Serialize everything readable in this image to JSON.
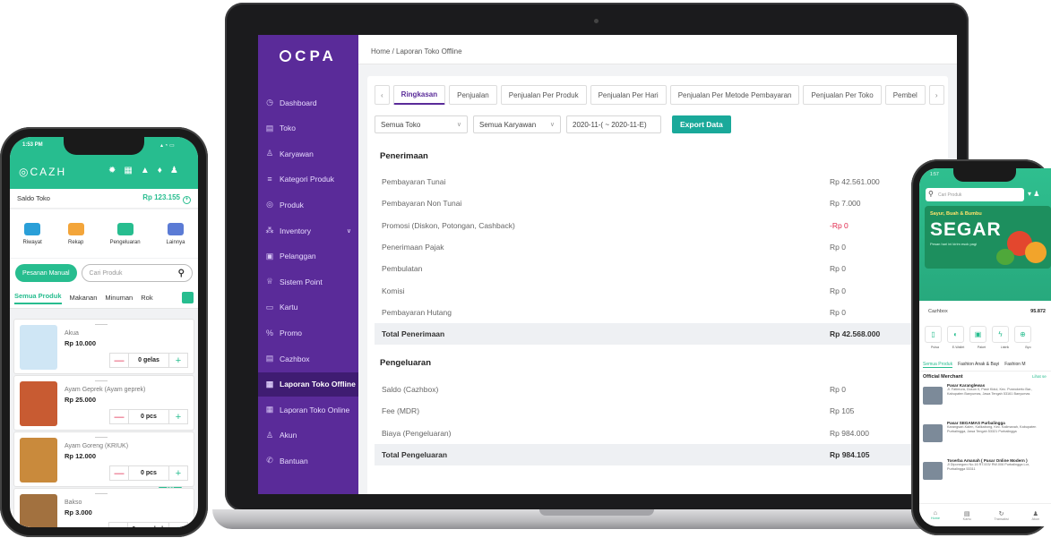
{
  "laptop": {
    "logo": "CPA",
    "sidebar": [
      {
        "label": "Dashboard",
        "icon": "dashboard-icon",
        "glyph": "◷"
      },
      {
        "label": "Toko",
        "icon": "store-icon",
        "glyph": "▤"
      },
      {
        "label": "Karyawan",
        "icon": "users-icon",
        "glyph": "♙"
      },
      {
        "label": "Kategori Produk",
        "icon": "list-icon",
        "glyph": "≡"
      },
      {
        "label": "Produk",
        "icon": "product-icon",
        "glyph": "◎"
      },
      {
        "label": "Inventory",
        "icon": "inventory-icon",
        "glyph": "⁂"
      },
      {
        "label": "Pelanggan",
        "icon": "customer-icon",
        "glyph": "▣"
      },
      {
        "label": "Sistem Point",
        "icon": "trophy-icon",
        "glyph": "♕"
      },
      {
        "label": "Kartu",
        "icon": "card-icon",
        "glyph": "▭"
      },
      {
        "label": "Promo",
        "icon": "percent-icon",
        "glyph": "%"
      },
      {
        "label": "Cazhbox",
        "icon": "box-icon",
        "glyph": "▤"
      },
      {
        "label": "Laporan Toko Offline",
        "icon": "report-icon",
        "glyph": "▦"
      },
      {
        "label": "Laporan Toko Online",
        "icon": "report-online-icon",
        "glyph": "▦"
      },
      {
        "label": "Akun",
        "icon": "account-icon",
        "glyph": "♙"
      },
      {
        "label": "Bantuan",
        "icon": "help-icon",
        "glyph": "✆"
      }
    ],
    "breadcrumb": "Home / Laporan Toko Offline",
    "tabs": [
      "Ringkasan",
      "Penjualan",
      "Penjualan Per Produk",
      "Penjualan Per Hari",
      "Penjualan Per Metode Pembayaran",
      "Penjualan Per Toko",
      "Pembel"
    ],
    "filters": {
      "store": "Semua Toko",
      "employee": "Semua Karyawan",
      "date": "2020-11-( ~ 2020-11-E)",
      "export": "Export Data"
    },
    "penerimaan": {
      "title": "Penerimaan",
      "rows": [
        {
          "label": "Pembayaran Tunai",
          "value": "Rp 42.561.000"
        },
        {
          "label": "Pembayaran Non Tunai",
          "value": "Rp 7.000"
        },
        {
          "label": "Promosi (Diskon, Potongan, Cashback)",
          "value": "-Rp 0"
        },
        {
          "label": "Penerimaan Pajak",
          "value": "Rp 0"
        },
        {
          "label": "Pembulatan",
          "value": "Rp 0"
        },
        {
          "label": "Komisi",
          "value": "Rp 0"
        },
        {
          "label": "Pembayaran Hutang",
          "value": "Rp 0"
        }
      ],
      "total": {
        "label": "Total Penerimaan",
        "value": "Rp 42.568.000"
      }
    },
    "pengeluaran": {
      "title": "Pengeluaran",
      "rows": [
        {
          "label": "Saldo (Cazhbox)",
          "value": "Rp 0"
        },
        {
          "label": "Fee (MDR)",
          "value": "Rp 105"
        },
        {
          "label": "Biaya (Pengeluaran)",
          "value": "Rp 984.000"
        }
      ],
      "total": {
        "label": "Total Pengeluaran",
        "value": "Rp 984.105"
      }
    },
    "colors": {
      "sidebar": "#5a2b99",
      "accent": "#1aa99a",
      "negative": "#e0284c"
    }
  },
  "phoneLeft": {
    "time": "1:53 PM",
    "brand": "CAZH",
    "saldo_label": "Saldo Toko",
    "saldo_value": "Rp 123.155",
    "quick": [
      {
        "label": "Riwayat",
        "color": "#2a9fd8"
      },
      {
        "label": "Rekap",
        "color": "#f3a53a"
      },
      {
        "label": "Pengeluaran",
        "color": "#27bd8f"
      },
      {
        "label": "Lainnya",
        "color": "#5b7bd5"
      }
    ],
    "manual_btn": "Pesanan Manual",
    "search_placeholder": "Cari Produk",
    "categories": [
      "Semua Produk",
      "Makanan",
      "Minuman",
      "Rok"
    ],
    "products": [
      {
        "name": "Akua",
        "price": "Rp 10.000",
        "qty": "0 gelas",
        "color": "#cfe6f5"
      },
      {
        "name": "Ayam Geprek (Ayam geprek)",
        "price": "Rp 25.000",
        "qty": "0 pcs",
        "color": "#c85b32"
      },
      {
        "name": "Ayam Goreng (KRIUK)",
        "price": "Rp 12.000",
        "qty": "0 pcs",
        "color": "#c98a3c"
      },
      {
        "name": "Bakso",
        "price": "Rp 3.000",
        "qty": "0 mangkok",
        "color": "#a2713f"
      }
    ],
    "accent": "#27bd8f"
  },
  "phoneRight": {
    "time": "1:57",
    "search_placeholder": "Cari Produk",
    "banner_top": "Sayur, Buah & Bumbu",
    "banner_big": "SEGAR",
    "banner_sub": "Pesan hari ini kirim esok pagi",
    "balance_label": "Cazhbox",
    "balance_value": "95.872",
    "icon_labels": [
      "Pulsa",
      "E-Wallet",
      "Paket",
      "Listrik",
      "Byo"
    ],
    "categories": [
      "Semua Produk",
      "Fashion Anak & Bayi",
      "Fashion M"
    ],
    "official_title": "Official Merchant",
    "official_link": "Lihat se",
    "merchants": [
      {
        "name": "Pasar Karanglewas",
        "address": "Jl. Fatimura, Dusun II, Pasir Kidul, Kec. Purwokerto Bar., Kabupaten Banyumas, Jawa Tengah 53161 Banyumas"
      },
      {
        "name": "Pasar SEGAMAS Purbalingga",
        "address": "Karangsari-Kalen, Kalikabong, Kec. Kalimanah, Kabupaten Purbalingga, Jawa Tengah 53321 Purbalingga"
      },
      {
        "name": "Toserba Amanah ( Pasar Online Modern )",
        "address": "Jl Diponegoro No.16 RT.003/ RW.006 Purbalingga Lor, Purbalingga 53311"
      }
    ],
    "nav": [
      "Home",
      "Kartu",
      "Transaksi",
      "Akun"
    ]
  }
}
